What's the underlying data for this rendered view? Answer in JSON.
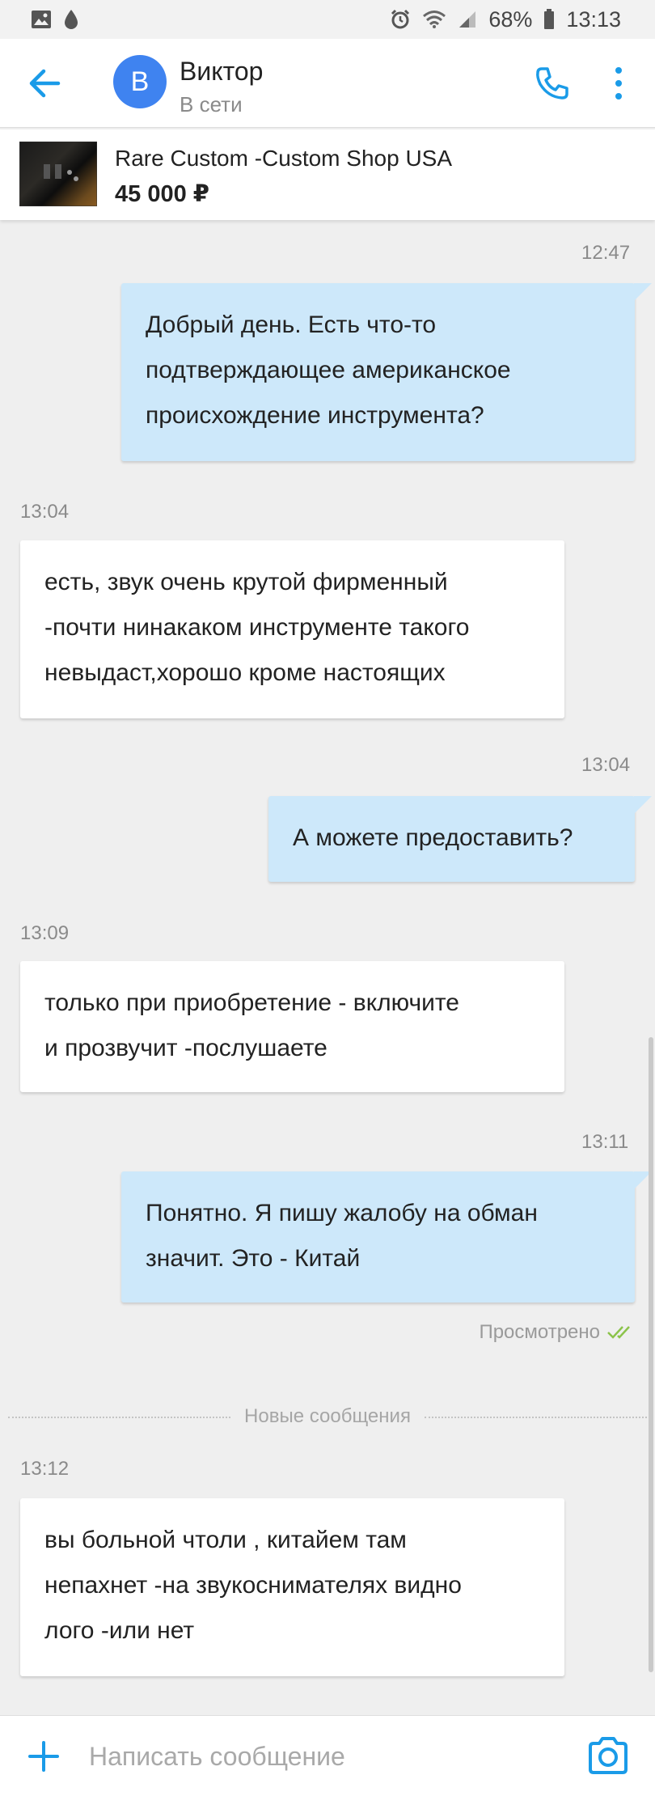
{
  "status_bar": {
    "battery": "68%",
    "time": "13:13"
  },
  "header": {
    "avatar_letter": "В",
    "contact_name": "Виктор",
    "contact_status": "В сети"
  },
  "product": {
    "title": "Rare Custom -Custom Shop USA",
    "price": "45 000 ₽"
  },
  "messages": [
    {
      "time": "12:47",
      "text": "Добрый день. Есть что-то\nподтверждающее американское\nпроисхождение инструмента?"
    },
    {
      "time": "13:04",
      "text": "есть, звук очень крутой фирменный\n-почти нинакаком инструменте такого\nневыдаст,хорошо кроме настоящих"
    },
    {
      "time": "13:04",
      "text": "А можете предоставить?"
    },
    {
      "time": "13:09",
      "text": "только при приобретение - включите\nи прозвучит -послушаете"
    },
    {
      "time": "13:11",
      "text": "Понятно. Я пишу жалобу на обман\nзначит. Это - Китай"
    },
    {
      "time": "13:12",
      "text": "вы больной чтоли , китайем там\nнепахнет -на звукоснимателях видно\nлого -или нет"
    }
  ],
  "seen_label": "Просмотрено",
  "new_messages_label": "Новые сообщения",
  "composer": {
    "placeholder": "Написать сообщение"
  },
  "colors": {
    "accent": "#1a9be8",
    "outgoing_bubble": "#cde8fa",
    "incoming_bubble": "#ffffff",
    "avatar": "#3f83f0",
    "seen_check": "#8bc34a"
  }
}
